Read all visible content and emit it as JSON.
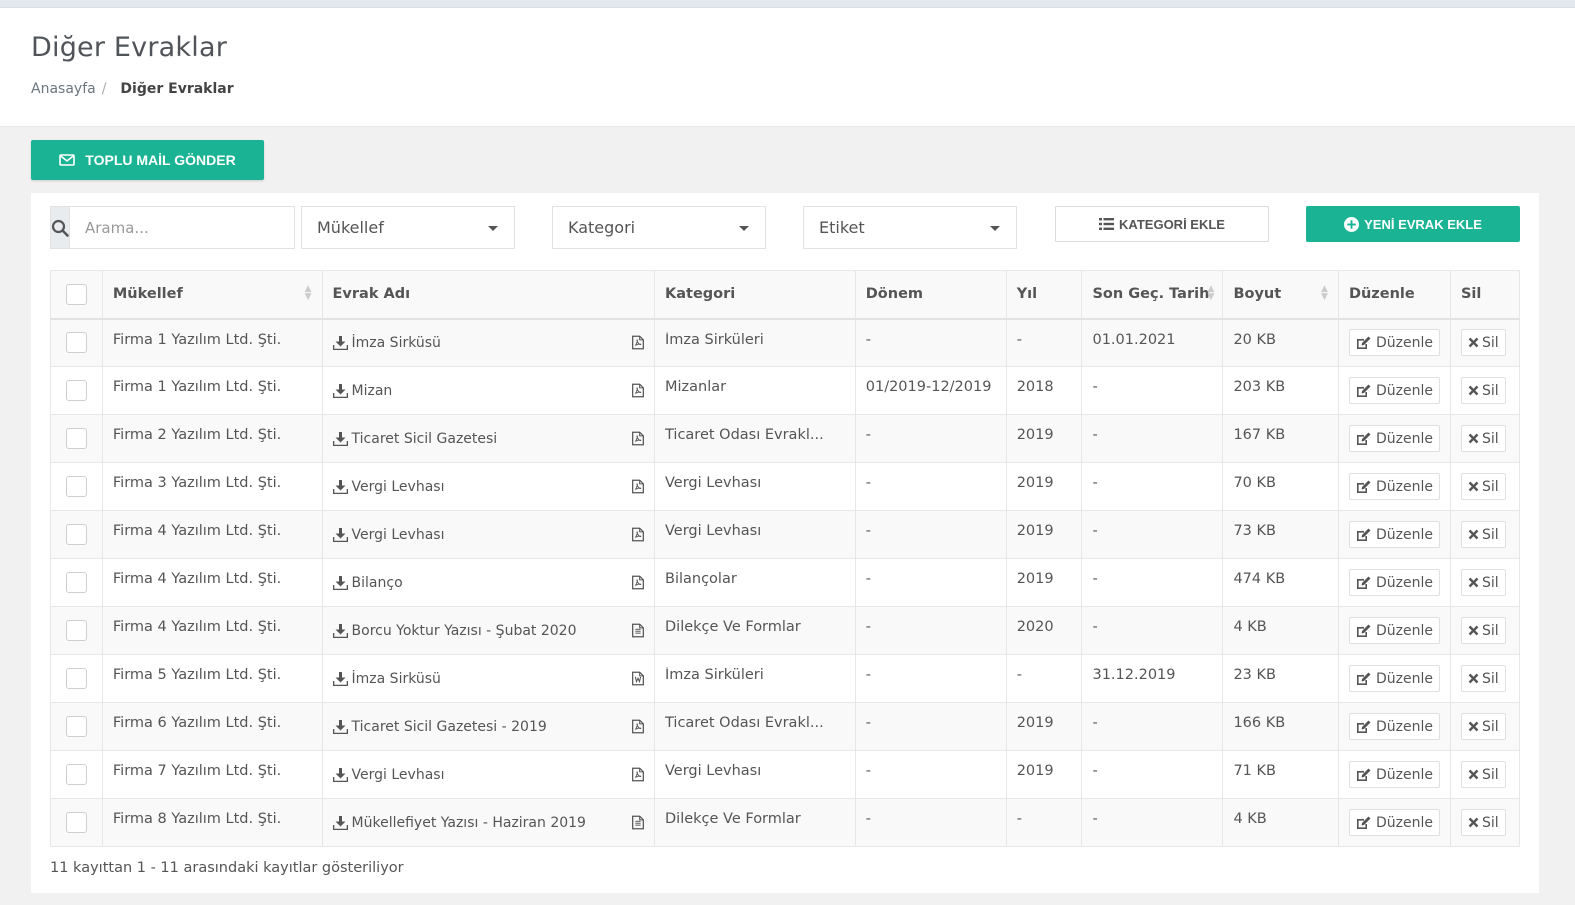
{
  "page": {
    "title": "Diğer Evraklar"
  },
  "breadcrumb": {
    "home": "Anasayfa",
    "separator": "/",
    "current": "Diğer Evraklar"
  },
  "toolbar": {
    "mail_button": "TOPLU MAİL GÖNDER",
    "search_placeholder": "Arama...",
    "filter_mukellef": "Mükellef",
    "filter_kategori": "Kategori",
    "filter_etiket": "Etiket",
    "add_category_button": "KATEGORİ EKLE",
    "new_document_button": "YENİ EVRAK EKLE"
  },
  "colors": {
    "accent": "#1ab394"
  },
  "table": {
    "headers": [
      "Mükellef",
      "Evrak Adı",
      "Kategori",
      "Dönem",
      "Yıl",
      "Son Geç. Tarih",
      "Boyut",
      "Düzenle",
      "Sil"
    ],
    "edit_label": "Düzenle",
    "delete_label": "Sil",
    "rows": [
      {
        "mukellef": "Firma 1 Yazılım Ltd. Şti.",
        "evrak": "İmza Sirküsü",
        "file_icon": "pdf-icon",
        "kategori": "İmza Sirküleri",
        "donem": "-",
        "yil": "-",
        "son_tarih": "01.01.2021",
        "boyut": "20 KB"
      },
      {
        "mukellef": "Firma 1 Yazılım Ltd. Şti.",
        "evrak": "Mizan",
        "file_icon": "pdf-icon",
        "kategori": "Mizanlar",
        "donem": "01/2019-12/2019",
        "yil": "2018",
        "son_tarih": "-",
        "boyut": "203 KB"
      },
      {
        "mukellef": "Firma 2 Yazılım Ltd. Şti.",
        "evrak": "Ticaret Sicil Gazetesi",
        "file_icon": "pdf-icon",
        "kategori": "Ticaret Odası Evrakl...",
        "donem": "-",
        "yil": "2019",
        "son_tarih": "-",
        "boyut": "167 KB"
      },
      {
        "mukellef": "Firma 3 Yazılım Ltd. Şti.",
        "evrak": "Vergi Levhası",
        "file_icon": "pdf-icon",
        "kategori": "Vergi Levhası",
        "donem": "-",
        "yil": "2019",
        "son_tarih": "-",
        "boyut": "70 KB"
      },
      {
        "mukellef": "Firma 4 Yazılım Ltd. Şti.",
        "evrak": "Vergi Levhası",
        "file_icon": "pdf-icon",
        "kategori": "Vergi Levhası",
        "donem": "-",
        "yil": "2019",
        "son_tarih": "-",
        "boyut": "73 KB"
      },
      {
        "mukellef": "Firma 4 Yazılım Ltd. Şti.",
        "evrak": "Bilanço",
        "file_icon": "pdf-icon",
        "kategori": "Bilançolar",
        "donem": "-",
        "yil": "2019",
        "son_tarih": "-",
        "boyut": "474 KB"
      },
      {
        "mukellef": "Firma 4 Yazılım Ltd. Şti.",
        "evrak": "Borcu Yoktur Yazısı - Şubat 2020",
        "file_icon": "text-file-icon",
        "kategori": "Dilekçe Ve Formlar",
        "donem": "-",
        "yil": "2020",
        "son_tarih": "-",
        "boyut": "4 KB"
      },
      {
        "mukellef": "Firma 5 Yazılım Ltd. Şti.",
        "evrak": "İmza Sirküsü",
        "file_icon": "word-file-icon",
        "kategori": "İmza Sirküleri",
        "donem": "-",
        "yil": "-",
        "son_tarih": "31.12.2019",
        "boyut": "23 KB"
      },
      {
        "mukellef": "Firma 6 Yazılım Ltd. Şti.",
        "evrak": "Ticaret Sicil Gazetesi - 2019",
        "file_icon": "pdf-icon",
        "kategori": "Ticaret Odası Evrakl...",
        "donem": "-",
        "yil": "2019",
        "son_tarih": "-",
        "boyut": "166 KB"
      },
      {
        "mukellef": "Firma 7 Yazılım Ltd. Şti.",
        "evrak": "Vergi Levhası",
        "file_icon": "pdf-icon",
        "kategori": "Vergi Levhası",
        "donem": "-",
        "yil": "2019",
        "son_tarih": "-",
        "boyut": "71 KB"
      },
      {
        "mukellef": "Firma 8 Yazılım Ltd. Şti.",
        "evrak": "Mükellefiyet Yazısı - Haziran 2019",
        "file_icon": "text-file-icon",
        "kategori": "Dilekçe Ve Formlar",
        "donem": "-",
        "yil": "-",
        "son_tarih": "-",
        "boyut": "4 KB"
      }
    ]
  },
  "footer": {
    "info": "11 kayıttan 1 - 11 arasındaki kayıtlar gösteriliyor"
  }
}
